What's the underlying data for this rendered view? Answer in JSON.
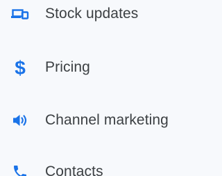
{
  "accent_color": "#1a73e8",
  "menu": {
    "items": [
      {
        "label": "Stock updates",
        "icon": "devices-icon"
      },
      {
        "label": "Pricing",
        "icon": "dollar-icon"
      },
      {
        "label": "Channel marketing",
        "icon": "speaker-icon"
      },
      {
        "label": "Contacts",
        "icon": "phone-icon"
      }
    ]
  }
}
